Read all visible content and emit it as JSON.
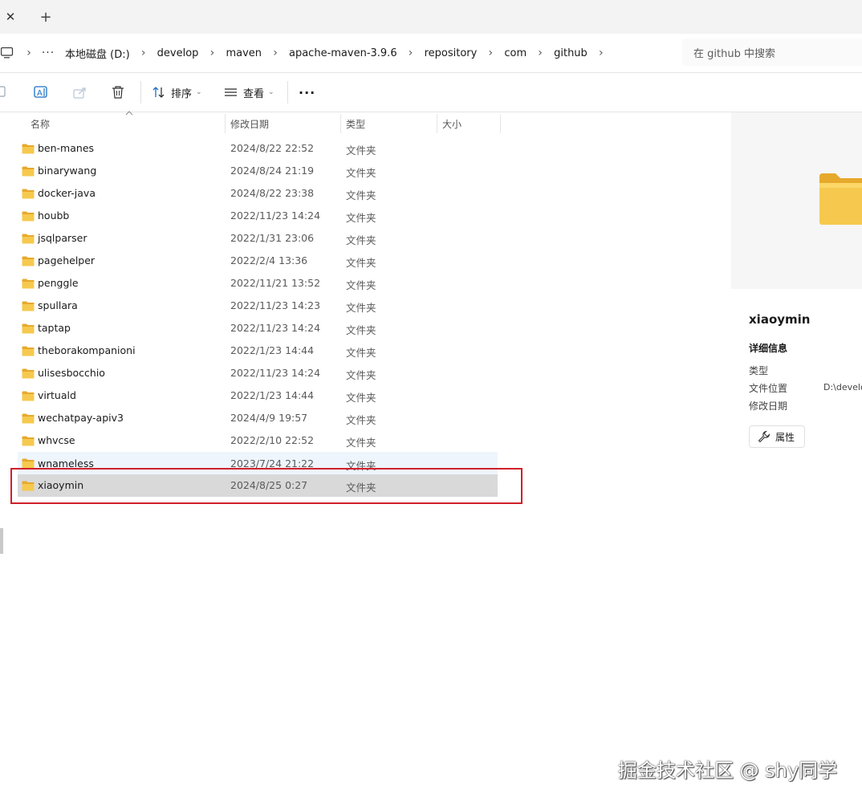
{
  "tabs": {
    "close_symbol": "✕",
    "new_symbol": "+"
  },
  "breadcrumb": {
    "more": "···",
    "items": [
      "本地磁盘 (D:)",
      "develop",
      "maven",
      "apache-maven-3.9.6",
      "repository",
      "com",
      "github"
    ],
    "separator": "›"
  },
  "search": {
    "placeholder": "在 github 中搜索"
  },
  "toolbar": {
    "sort_label": "排序",
    "view_label": "查看",
    "more_symbol": "···",
    "icons": [
      "copy-icon",
      "rename-icon",
      "share-icon",
      "delete-icon",
      "sort-icon",
      "view-icon",
      "more-icon"
    ]
  },
  "columns": {
    "name": "名称",
    "modified": "修改日期",
    "type": "类型",
    "size": "大小"
  },
  "files": [
    {
      "name": "ben-manes",
      "modified": "2024/8/22 22:52",
      "type": "文件夹"
    },
    {
      "name": "binarywang",
      "modified": "2024/8/24 21:19",
      "type": "文件夹"
    },
    {
      "name": "docker-java",
      "modified": "2024/8/22 23:38",
      "type": "文件夹"
    },
    {
      "name": "houbb",
      "modified": "2022/11/23 14:24",
      "type": "文件夹"
    },
    {
      "name": "jsqlparser",
      "modified": "2022/1/31 23:06",
      "type": "文件夹"
    },
    {
      "name": "pagehelper",
      "modified": "2022/2/4 13:36",
      "type": "文件夹"
    },
    {
      "name": "penggle",
      "modified": "2022/11/21 13:52",
      "type": "文件夹"
    },
    {
      "name": "spullara",
      "modified": "2022/11/23 14:23",
      "type": "文件夹"
    },
    {
      "name": "taptap",
      "modified": "2022/11/23 14:24",
      "type": "文件夹"
    },
    {
      "name": "theborakompanioni",
      "modified": "2022/1/23 14:44",
      "type": "文件夹"
    },
    {
      "name": "ulisesbocchio",
      "modified": "2022/11/23 14:24",
      "type": "文件夹"
    },
    {
      "name": "virtuald",
      "modified": "2022/1/23 14:44",
      "type": "文件夹"
    },
    {
      "name": "wechatpay-apiv3",
      "modified": "2024/4/9 19:57",
      "type": "文件夹"
    },
    {
      "name": "whvcse",
      "modified": "2022/2/10 22:52",
      "type": "文件夹"
    },
    {
      "name": "wnameless",
      "modified": "2023/7/24 21:22",
      "type": "文件夹"
    },
    {
      "name": "xiaoymin",
      "modified": "2024/8/25 0:27",
      "type": "文件夹"
    }
  ],
  "details": {
    "title": "xiaoymin",
    "section": "详细信息",
    "type_label": "类型",
    "location_label": "文件位置",
    "location_value": "D:\\develo",
    "modified_label": "修改日期",
    "properties_label": "属性"
  },
  "colors": {
    "highlight_border": "#d0202a",
    "selected_row": "#d9d9d9",
    "hover_row": "#eef5fc",
    "folder": "#f3c24a"
  },
  "watermark": "掘金技术社区 @ shy同学"
}
